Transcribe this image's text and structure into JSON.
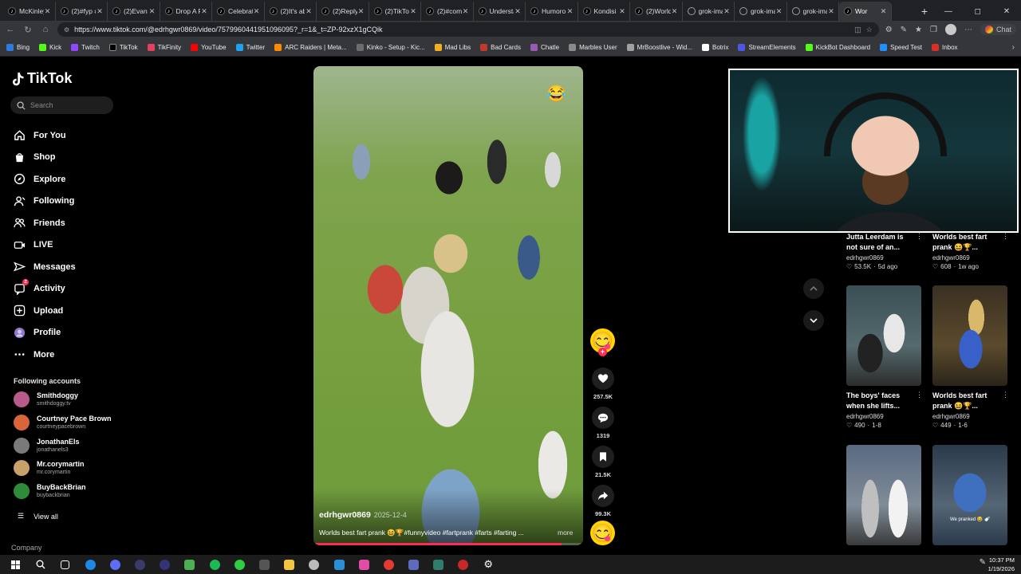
{
  "browser": {
    "tabs": [
      {
        "label": "McKinley",
        "fav": "tiktok"
      },
      {
        "label": "(2)#fyp #",
        "fav": "tiktok"
      },
      {
        "label": "(2)Evan T.",
        "fav": "tiktok"
      },
      {
        "label": "Drop A F",
        "fav": "tiktok"
      },
      {
        "label": "Celebrat",
        "fav": "tiktok"
      },
      {
        "label": "(2)It's ab",
        "fav": "tiktok"
      },
      {
        "label": "(2)Replyi",
        "fav": "tiktok"
      },
      {
        "label": "(2)TikTok",
        "fav": "tiktok"
      },
      {
        "label": "(2)#come",
        "fav": "tiktok"
      },
      {
        "label": "Understa",
        "fav": "tiktok"
      },
      {
        "label": "Humoro",
        "fav": "tiktok"
      },
      {
        "label": "Kondisi K",
        "fav": "tiktok"
      },
      {
        "label": "(2)World",
        "fav": "tiktok"
      },
      {
        "label": "grok-ima",
        "fav": "globe"
      },
      {
        "label": "grok-ima",
        "fav": "globe"
      },
      {
        "label": "grok-ima",
        "fav": "globe"
      },
      {
        "label": "Wor",
        "fav": "tiktok",
        "active": true
      }
    ],
    "url": "https://www.tiktok.com/@edrhgwr0869/video/7579960441951096095?_r=1&_t=ZP-92xzX1gCQik",
    "chat_label": "Chat",
    "bookmarks": [
      {
        "label": "Bing",
        "color": "#2d7be0"
      },
      {
        "label": "Kick",
        "color": "#53fc18"
      },
      {
        "label": "Twitch",
        "color": "#9146ff"
      },
      {
        "label": "TikTok",
        "color": "#000000"
      },
      {
        "label": "TikFinity",
        "color": "#e4405f"
      },
      {
        "label": "YouTube",
        "color": "#ff0000"
      },
      {
        "label": "Twitter",
        "color": "#1da1f2"
      },
      {
        "label": "ARC Raiders | Meta...",
        "color": "#ff8a00"
      },
      {
        "label": "Kinko - Setup - Kic...",
        "color": "#6d6d6d"
      },
      {
        "label": "Mad Libs",
        "color": "#f2b01e"
      },
      {
        "label": "Bad Cards",
        "color": "#c0392b"
      },
      {
        "label": "Chatle",
        "color": "#9b59b6"
      },
      {
        "label": "Marbles User",
        "color": "#8a8a8a"
      },
      {
        "label": "MrBoostlive - Wid...",
        "color": "#a0a0a0"
      },
      {
        "label": "Botrix",
        "color": "#ffffff"
      },
      {
        "label": "StreamElements",
        "color": "#4e56e6"
      },
      {
        "label": "KickBot Dashboard",
        "color": "#53fc18"
      },
      {
        "label": "Speed Test",
        "color": "#1e90ff"
      },
      {
        "label": "Inbox",
        "color": "#d93025"
      }
    ]
  },
  "tiktok": {
    "logo_text": "TikTok",
    "search_placeholder": "Search",
    "nav": [
      {
        "label": "For You",
        "icon": "home-icon"
      },
      {
        "label": "Shop",
        "icon": "shop-icon"
      },
      {
        "label": "Explore",
        "icon": "compass-icon"
      },
      {
        "label": "Following",
        "icon": "following-icon"
      },
      {
        "label": "Friends",
        "icon": "friends-icon"
      },
      {
        "label": "LIVE",
        "icon": "live-icon"
      },
      {
        "label": "Messages",
        "icon": "messages-icon"
      },
      {
        "label": "Activity",
        "icon": "activity-icon",
        "badge": "2"
      },
      {
        "label": "Upload",
        "icon": "upload-icon"
      },
      {
        "label": "Profile",
        "icon": "profile-icon"
      },
      {
        "label": "More",
        "icon": "more-icon"
      }
    ],
    "following_header": "Following accounts",
    "accounts": [
      {
        "name": "Smithdoggy",
        "handle": "smithdoggy.tv",
        "color": "#b85a8a"
      },
      {
        "name": "Courtney Pace Brown",
        "handle": "courtneypacebrown",
        "color": "#d9653b"
      },
      {
        "name": "JonathanEls",
        "handle": "jonathanels3",
        "color": "#7a7a7a"
      },
      {
        "name": "Mr.corymartin",
        "handle": "mr.corymartin",
        "color": "#c8a16a"
      },
      {
        "name": "BuyBackBrian",
        "handle": "buybackbrian",
        "color": "#2e8b3a"
      }
    ],
    "view_all": "View all",
    "company": "Company",
    "video": {
      "author": "edrhgwr0869",
      "date": "2025-12-4",
      "caption": "Worlds best fart prank 😆🏆#funnyvideo #fartprank #farts #farting ...",
      "more": "more",
      "progress": 0.92,
      "likes": "257.5K",
      "comments": "1319",
      "saves": "21.5K",
      "shares": "99.3K"
    },
    "recommendations": [
      {
        "title": "Jutta Leerdam is not sure of an...",
        "user": "edrhgwr0869",
        "likes": "53.5K",
        "age": "5d ago"
      },
      {
        "title": "Worlds best fart prank 😆🏆...",
        "user": "edrhgwr0869",
        "likes": "608",
        "age": "1w ago"
      },
      {
        "title": "The boys' faces when she lifts...",
        "user": "edrhgwr0869",
        "likes": "490",
        "age": "1-8"
      },
      {
        "title": "Worlds best fart prank 😆🏆...",
        "user": "edrhgwr0869",
        "likes": "449",
        "age": "1-6"
      },
      {
        "thumb_text": "We pranked 😂 🍼"
      }
    ]
  },
  "taskbar": {
    "time": "10:37 PM",
    "date": "1/19/2026"
  }
}
